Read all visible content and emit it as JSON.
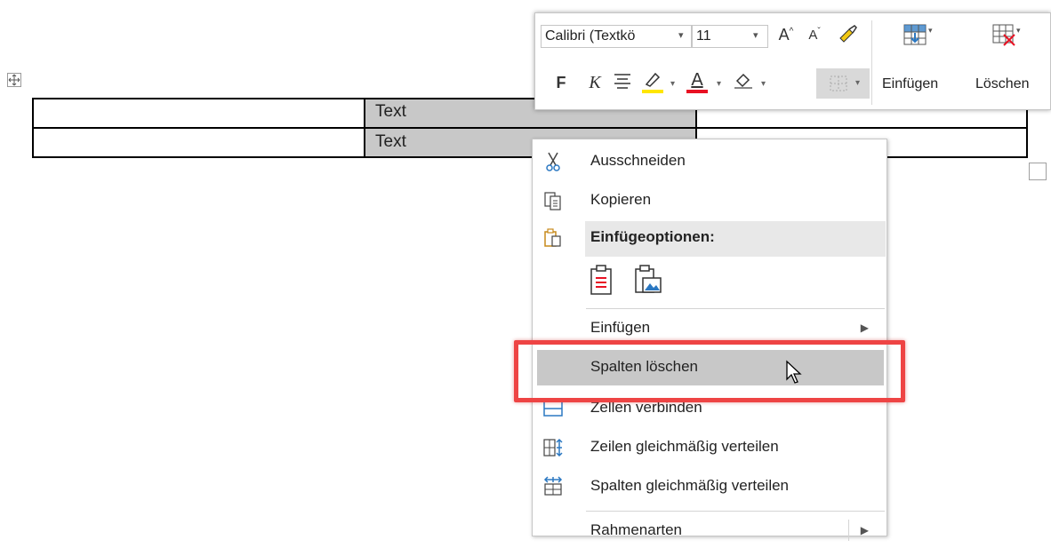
{
  "table": {
    "cells": [
      [
        "",
        "Text",
        ""
      ],
      [
        "",
        "Text",
        ""
      ]
    ]
  },
  "mini_toolbar": {
    "font_name": "Calibri (Textkö",
    "font_size": "11",
    "grow_font_glyph": "A",
    "shrink_font_glyph": "A",
    "bold_glyph": "F",
    "italic_glyph": "K",
    "font_color_glyph": "A",
    "insert_label": "Einfügen",
    "delete_label": "Löschen",
    "highlight_color": "#ffe600",
    "font_color": "#e81123"
  },
  "context_menu": {
    "items": [
      {
        "label": "Ausschneiden",
        "icon": "scissors-icon"
      },
      {
        "label": "Kopieren",
        "icon": "copy-icon"
      },
      {
        "label": "Einfügeoptionen:",
        "icon": "paste-icon"
      },
      {
        "label": "Einfügen",
        "icon": "",
        "submenu": true
      },
      {
        "label": "Spalten löschen",
        "icon": ""
      },
      {
        "label": "Zellen verbinden",
        "icon": "merge-cells-icon"
      },
      {
        "label": "Zeilen gleichmäßig verteilen",
        "icon": "distribute-rows-icon"
      },
      {
        "label": "Spalten gleichmäßig verteilen",
        "icon": "distribute-columns-icon"
      },
      {
        "label": "Rahmenarten",
        "icon": "",
        "submenu": true
      }
    ]
  },
  "colors": {
    "highlight_frame": "#ee4444",
    "selected_cell": "#c8c8c8",
    "icon_blue": "#2b78c2"
  }
}
